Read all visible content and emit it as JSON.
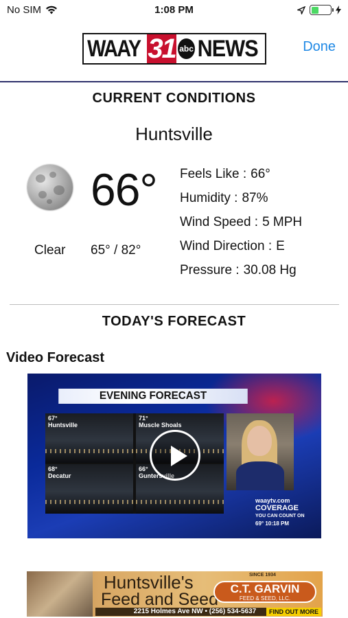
{
  "status_bar": {
    "carrier": "No SIM",
    "time": "1:08 PM",
    "battery_level": 0.4
  },
  "nav": {
    "logo": {
      "part1": "WAAY",
      "part2": "31",
      "part3": "abc",
      "part4": "NEWS"
    },
    "done_label": "Done"
  },
  "current": {
    "heading": "CURRENT CONDITIONS",
    "city": "Huntsville",
    "icon": "moon-icon",
    "temperature": "66°",
    "condition": "Clear",
    "hi_lo": "65° / 82°",
    "details": [
      {
        "label": "Feels Like :",
        "value": "66°"
      },
      {
        "label": "Humidity :",
        "value": "87%"
      },
      {
        "label": "Wind Speed :",
        "value": "5 MPH"
      },
      {
        "label": "Wind Direction :",
        "value": "E"
      },
      {
        "label": "Pressure :",
        "value": "30.08 Hg"
      }
    ]
  },
  "forecast": {
    "heading": "TODAY'S FORECAST",
    "video_label": "Video Forecast",
    "video": {
      "banner": "EVENING FORECAST",
      "cams": [
        {
          "temp": "67°",
          "city": "Huntsville"
        },
        {
          "temp": "71°",
          "city": "Muscle Shoals"
        },
        {
          "temp": "68°",
          "city": "Decatur"
        },
        {
          "temp": "66°",
          "city": "Guntersville"
        }
      ],
      "site": "waaytv.com",
      "coverage": "COVERAGE",
      "tagline": "YOU CAN COUNT ON",
      "ticker": "69°   10:18 PM"
    }
  },
  "ad": {
    "headline1": "Huntsville's",
    "headline2": "Feed and Seed",
    "address": "2215 Holmes Ave NW • (256) 534-5637",
    "brand": "C.T. GARVIN",
    "brand_sub": "FEED & SEED, LLC.",
    "since": "SINCE 1934",
    "cta": "FIND OUT MORE"
  }
}
